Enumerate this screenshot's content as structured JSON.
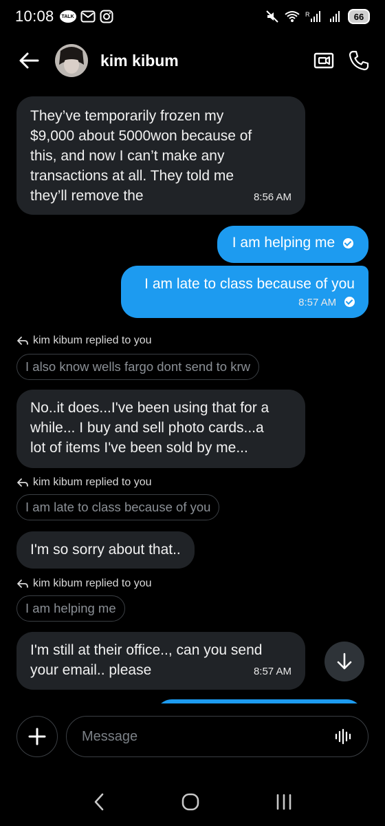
{
  "status_bar": {
    "time": "10:08",
    "talk_badge": "TALK",
    "battery": "66",
    "network": "R"
  },
  "header": {
    "contact_name": "kim kibum"
  },
  "messages": {
    "m1": {
      "line1": "They’ve temporarily frozen my",
      "line2": "$9,000 about 5000won  because of",
      "line3": "this, and now I can’t make any",
      "line4": "transactions at all. They told me",
      "line5": "they’ll remove the",
      "time": "8:56 AM"
    },
    "m2": {
      "text": "I am helping me"
    },
    "m3": {
      "text": "I am late to class because of you",
      "time": "8:57 AM"
    },
    "r1": {
      "label": "kim kibum replied to you",
      "quote": "I also know wells fargo dont send to krw",
      "line1": "No..it does...I've been using that for a",
      "line2": "while... I buy and sell photo cards...a",
      "line3": "lot of items I've been sold by me..."
    },
    "r2": {
      "label": "kim kibum replied to you",
      "quote": "I am late to class because of you",
      "text": "I'm so sorry about that.."
    },
    "r3": {
      "label": "kim kibum replied to you",
      "quote": "I am helping me",
      "line1": "I'm still at their office.., can you send",
      "line2": "your email.. please",
      "time": "8:57 AM"
    }
  },
  "composer": {
    "placeholder": "Message"
  },
  "colors": {
    "background": "#000000",
    "incoming_bubble": "#202327",
    "outgoing_bubble": "#1d9bf0",
    "border": "#3b3f44"
  },
  "icons": {
    "back": "arrow-left-icon",
    "video": "video-camera-icon",
    "phone": "phone-icon",
    "reply": "reply-arrow-icon",
    "scroll": "arrow-down-icon",
    "add": "plus-icon",
    "voice": "voice-wave-icon"
  }
}
